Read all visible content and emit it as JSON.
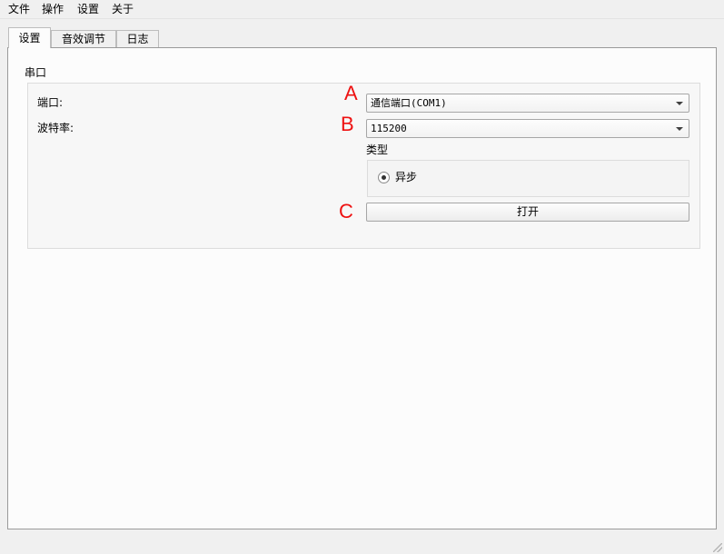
{
  "menubar": {
    "items": [
      "文件",
      "操作",
      "设置",
      "关于"
    ]
  },
  "tabs": {
    "items": [
      "设置",
      "音效调节",
      "日志"
    ],
    "active": "设置"
  },
  "serial": {
    "group_title": "串口",
    "port_label": "端口:",
    "baud_label": "波特率:",
    "port_value": "通信端口(COM1)",
    "baud_value": "115200",
    "type_label": "类型",
    "radio_label": "异步",
    "radio_checked": true,
    "open_button": "打开"
  },
  "markers": {
    "a": "A",
    "b": "B",
    "c": "C",
    "color": "#ee1111"
  },
  "icons": {
    "dropdown": "chevron-down-icon",
    "resize": "resize-grip-icon"
  }
}
